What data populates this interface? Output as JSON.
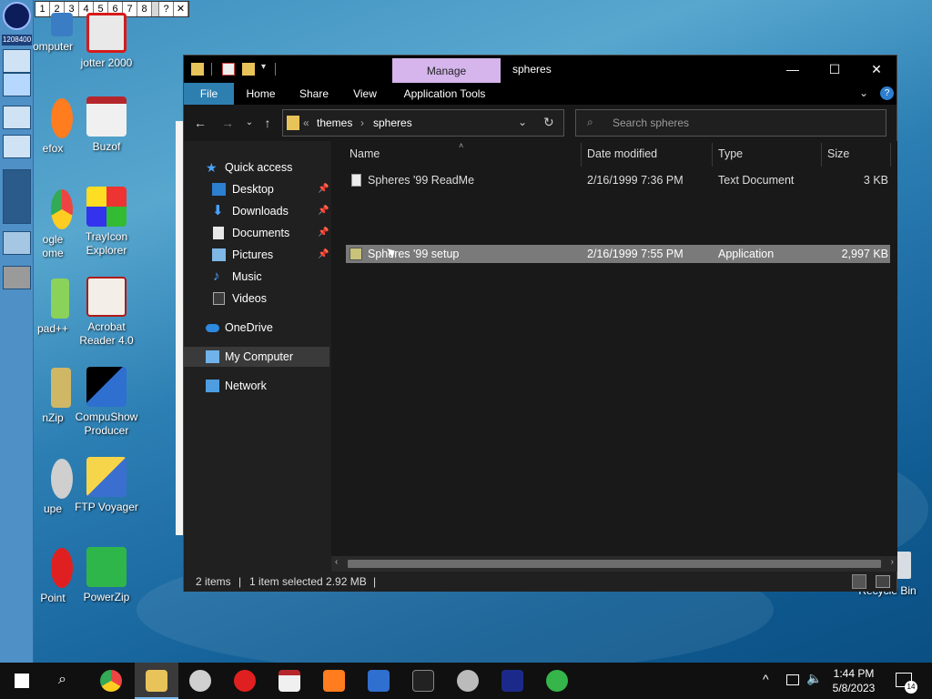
{
  "desktop": {
    "dock_number": "1208400",
    "minibar": [
      "1",
      "2",
      "3",
      "4",
      "5",
      "6",
      "7",
      "8",
      "?",
      "✕"
    ],
    "icons": [
      {
        "label": "omputer",
        "id": "computer"
      },
      {
        "label": "jotter 2000",
        "id": "jotter"
      },
      {
        "label": "efox",
        "id": "firefox"
      },
      {
        "label": "Buzof",
        "id": "buzof"
      },
      {
        "label": "ogle\nome",
        "id": "chrome"
      },
      {
        "label": "TrayIcon\nExplorer",
        "id": "trayicon"
      },
      {
        "label": "pad++",
        "id": "notepad"
      },
      {
        "label": "Acrobat\nReader 4.0",
        "id": "acrobat"
      },
      {
        "label": "nZip",
        "id": "winzip"
      },
      {
        "label": "CompuShow\nProducer",
        "id": "compushow"
      },
      {
        "label": "upe",
        "id": "snoop"
      },
      {
        "label": "FTP Voyager",
        "id": "ftpvoyager"
      },
      {
        "label": "Point",
        "id": "powerpoint"
      },
      {
        "label": "PowerZip",
        "id": "powerzip"
      },
      {
        "label": "Recycle Bin",
        "id": "recycle"
      }
    ]
  },
  "window": {
    "manage_tab": "Manage",
    "title": "spheres",
    "controls": {
      "minimize": "—",
      "maximize": "☐",
      "close": "✕"
    },
    "ribbon_tabs": [
      "File",
      "Home",
      "Share",
      "View",
      "Application Tools"
    ],
    "breadcrumb": {
      "sep_lead": "«",
      "parts": [
        "themes",
        "spheres"
      ],
      "sep": "›"
    },
    "search_placeholder": "Search spheres",
    "nav": {
      "quick_access": "Quick access",
      "items": [
        "Desktop",
        "Downloads",
        "Documents",
        "Pictures",
        "Music",
        "Videos"
      ],
      "onedrive": "OneDrive",
      "mycomputer": "My Computer",
      "network": "Network"
    },
    "columns": [
      "Name",
      "Date modified",
      "Type",
      "Size"
    ],
    "files": [
      {
        "name": "Spheres '99 ReadMe",
        "date": "2/16/1999 7:36 PM",
        "type": "Text Document",
        "size": "3 KB"
      },
      {
        "name": "Spheres '99 setup",
        "date": "2/16/1999 7:55 PM",
        "type": "Application",
        "size": "2,997 KB"
      }
    ],
    "status": {
      "count": "2 items",
      "sep": "|",
      "selected": "1 item selected  2.92 MB"
    }
  },
  "taskbar": {
    "time": "1:44 PM",
    "date": "5/8/2023",
    "notifications": "14"
  },
  "colors": {
    "accent": "#2d7fb0",
    "manage": "#d5b5ec",
    "selection": "#7a7a7a"
  }
}
